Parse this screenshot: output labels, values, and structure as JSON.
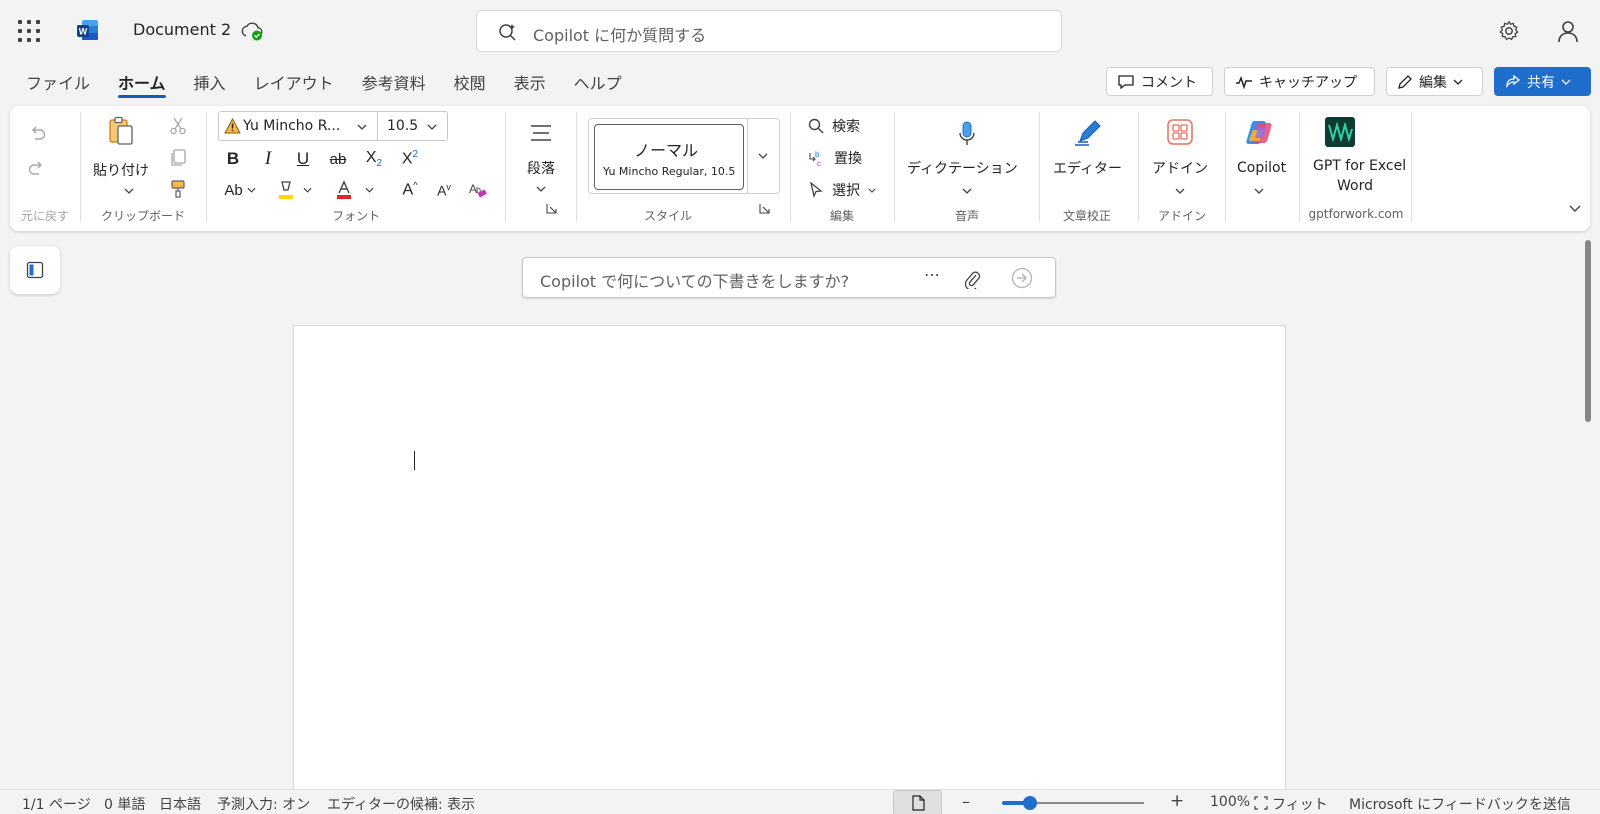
{
  "title_bar": {
    "document_title": "Document 2",
    "search_placeholder": "Copilot に何か質問する"
  },
  "tabs": [
    {
      "label": "ファイル",
      "active": false
    },
    {
      "label": "ホーム",
      "active": true
    },
    {
      "label": "挿入",
      "active": false
    },
    {
      "label": "レイアウト",
      "active": false
    },
    {
      "label": "参考資料",
      "active": false
    },
    {
      "label": "校閲",
      "active": false
    },
    {
      "label": "表示",
      "active": false
    },
    {
      "label": "ヘルプ",
      "active": false
    }
  ],
  "actions": {
    "comment": "コメント",
    "catchup": "キャッチアップ",
    "edit": "編集",
    "share": "共有"
  },
  "ribbon": {
    "undo_group": {
      "label": "元に戻す"
    },
    "clipboard": {
      "label": "クリップボード",
      "paste": "貼り付け"
    },
    "font": {
      "label": "フォント",
      "font_name": "Yu Mincho R...",
      "font_size": "10.5"
    },
    "paragraph": {
      "label": "段落"
    },
    "styles": {
      "label": "スタイル",
      "style_name": "ノーマル",
      "style_desc": "Yu Mincho Regular, 10.5"
    },
    "editing": {
      "label": "編集",
      "find": "検索",
      "replace": "置換",
      "select": "選択"
    },
    "voice": {
      "label": "音声",
      "dictate": "ディクテーション"
    },
    "proofing": {
      "label": "文章校正",
      "editor": "エディター"
    },
    "addins": {
      "label": "アドイン",
      "addins_button": "アドイン"
    },
    "copilot": {
      "label": "Copilot"
    },
    "gpt": {
      "line1": "GPT for Excel",
      "line2": "Word",
      "group_label": "gptforwork.com"
    }
  },
  "draft_prompt": {
    "placeholder": "Copilot で何についての下書きをしますか?"
  },
  "status_bar": {
    "page": "1/1 ページ",
    "words": "0 単語",
    "language": "日本語",
    "predictive": "予測入力: オン",
    "editor_suggestions": "エディターの候補: 表示",
    "zoom_percent": "100%",
    "zoom_level": 0.2,
    "fit": "フィット",
    "feedback": "Microsoft にフィードバックを送信"
  },
  "colors": {
    "accent": "#185abd",
    "share_button": "#1f6ecc",
    "font_color_red": "#e3242b",
    "highlight_yellow": "#ffd700"
  }
}
